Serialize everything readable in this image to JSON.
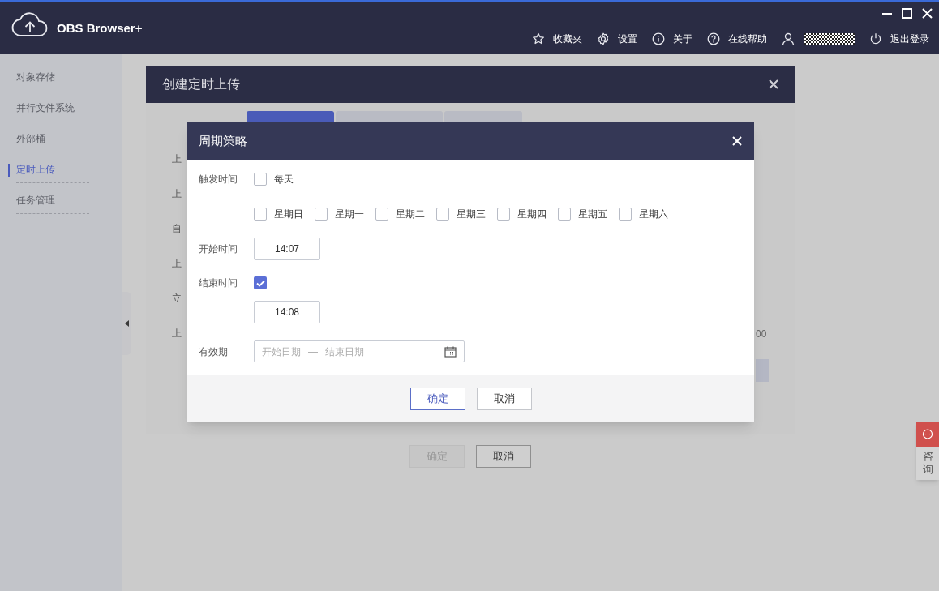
{
  "window": {
    "title": "OBS Browser+"
  },
  "header_actions": [
    {
      "kind": "star",
      "label": "收藏夹"
    },
    {
      "kind": "gear",
      "label": "设置"
    },
    {
      "kind": "info",
      "label": "关于"
    },
    {
      "kind": "help",
      "label": "在线帮助"
    },
    {
      "kind": "user"
    },
    {
      "kind": "power",
      "label": "退出登录"
    }
  ],
  "sidebar": {
    "items": [
      {
        "label": "对象存储",
        "selected": false
      },
      {
        "label": "并行文件系统",
        "selected": false
      },
      {
        "label": "外部桶",
        "selected": false
      },
      {
        "label": "定时上传",
        "selected": true
      },
      {
        "label": "任务管理",
        "selected": false
      }
    ]
  },
  "outer_dialog": {
    "title": "创建定时上传",
    "tabs": [
      {
        "selected": true
      },
      {
        "selected": false
      },
      {
        "selected": false
      }
    ],
    "field_labels": [
      "上",
      "上",
      "自",
      "上",
      "立",
      "上"
    ],
    "side_value": "00",
    "buttons": [
      {
        "label": "确定",
        "disabled": true
      },
      {
        "label": "取消",
        "disabled": false
      }
    ]
  },
  "inner_dialog": {
    "title": "周期策略",
    "trigger": {
      "label": "触发时间",
      "daily": {
        "label": "每天",
        "checked": false
      },
      "weekdays": [
        {
          "label": "星期日",
          "checked": false
        },
        {
          "label": "星期一",
          "checked": false
        },
        {
          "label": "星期二",
          "checked": false
        },
        {
          "label": "星期三",
          "checked": false
        },
        {
          "label": "星期四",
          "checked": false
        },
        {
          "label": "星期五",
          "checked": false
        },
        {
          "label": "星期六",
          "checked": false
        }
      ]
    },
    "start_time": {
      "label": "开始时间",
      "value": "14:07"
    },
    "end_time": {
      "label": "结束时间",
      "checked": true,
      "value": "14:08"
    },
    "validity": {
      "label": "有效期",
      "start_placeholder": "开始日期",
      "separator": "—",
      "end_placeholder": "结束日期"
    },
    "buttons": [
      {
        "kind": "primary",
        "label": "确定"
      },
      {
        "kind": "default",
        "label": "取消"
      }
    ]
  },
  "consult": {
    "label": "咨询"
  }
}
